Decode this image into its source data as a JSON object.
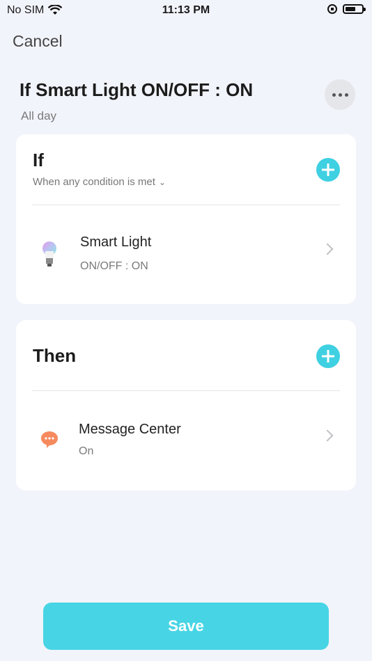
{
  "status_bar": {
    "carrier": "No SIM",
    "time": "11:13 PM"
  },
  "header": {
    "cancel_label": "Cancel",
    "title": "If Smart Light ON/OFF : ON",
    "schedule": "All day"
  },
  "if_card": {
    "heading": "If",
    "condition_mode": "When any condition is met",
    "items": [
      {
        "device": "Smart Light",
        "state": "ON/OFF : ON"
      }
    ]
  },
  "then_card": {
    "heading": "Then",
    "items": [
      {
        "action": "Message Center",
        "state": "On"
      }
    ]
  },
  "footer": {
    "save_label": "Save"
  },
  "colors": {
    "accent": "#3fd0e2",
    "save_button": "#47d5e5",
    "background": "#f2f4fb"
  }
}
